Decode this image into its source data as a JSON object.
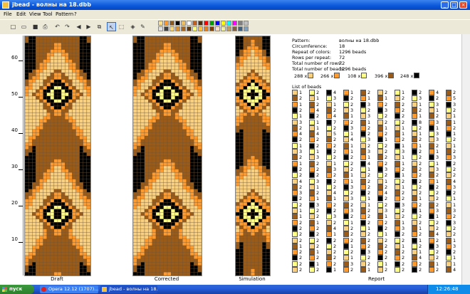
{
  "window": {
    "title": "jbead - волны на 18.dbb",
    "minimize_label": "_",
    "maximize_label": "□",
    "close_label": "×"
  },
  "menu": [
    {
      "label": "File"
    },
    {
      "label": "Edit"
    },
    {
      "label": "View"
    },
    {
      "label": "Tool"
    },
    {
      "label": "Pattern"
    },
    {
      "label": "?"
    }
  ],
  "toolbar": {
    "buttons": [
      {
        "name": "new-icon",
        "glyph": "□"
      },
      {
        "name": "open-icon",
        "glyph": "▭"
      },
      {
        "name": "save-icon",
        "glyph": "■"
      },
      {
        "name": "print-icon",
        "glyph": "⎙"
      },
      {
        "name": "undo-icon",
        "glyph": "↶"
      },
      {
        "name": "redo-icon",
        "glyph": "↷"
      },
      {
        "name": "rotate-left-icon",
        "glyph": "◀"
      },
      {
        "name": "rotate-right-icon",
        "glyph": "▶"
      },
      {
        "name": "copy-icon",
        "glyph": "⧉"
      },
      {
        "name": "pointer-icon",
        "glyph": "↖"
      },
      {
        "name": "select-icon",
        "glyph": "⬚"
      },
      {
        "name": "fill-icon",
        "glyph": "◈"
      },
      {
        "name": "pipette-icon",
        "glyph": "✎"
      }
    ],
    "palette": [
      "#ffe08a",
      "#ff9a2e",
      "#8a5a1e",
      "#000000",
      "#f0c060",
      "#ffffff",
      "#c06020",
      "#503010",
      "#ff0000",
      "#00a000",
      "#0000ff",
      "#ffff00",
      "#00ffff",
      "#ff00ff",
      "#808080",
      "#c0c0c0",
      "#e0e0e0",
      "#404040",
      "#f8d878",
      "#d89030",
      "#a86820",
      "#603810",
      "#ffff80",
      "#ffc040",
      "#e08020",
      "#804000",
      "#ffe0c0",
      "#f0f0a0",
      "#c0a060",
      "#806040",
      "#406080",
      "#80a0c0"
    ]
  },
  "ruler": {
    "ticks": [
      "60",
      "50",
      "40",
      "30",
      "20",
      "10"
    ]
  },
  "views": [
    {
      "label": "Draft"
    },
    {
      "label": "Corrected"
    },
    {
      "label": "Simulation"
    },
    {
      "label": "Report"
    }
  ],
  "info": {
    "rows": [
      {
        "label": "Pattern:",
        "value": "волны на 18.dbb"
      },
      {
        "label": "Circumference:",
        "value": "18"
      },
      {
        "label": "Repeat of colors:",
        "value": "1296 beads"
      },
      {
        "label": "Rows per repeat:",
        "value": "72"
      },
      {
        "label": "Total number of rows:",
        "value": "72"
      },
      {
        "label": "Total number of beads:",
        "value": "1296 beads"
      }
    ]
  },
  "bead_counts": [
    {
      "count": "288 x",
      "color": "#f8d080"
    },
    {
      "count": "266 x",
      "color": "#ff9a2e"
    },
    {
      "count": "108 x",
      "color": "#ffff88"
    },
    {
      "count": "396 x",
      "color": "#9a5a18"
    },
    {
      "count": "248 x",
      "color": "#000000"
    }
  ],
  "list_title": "List of beads",
  "colors": {
    "light": "#f8d080",
    "orange": "#ff9a2e",
    "yellow": "#ffff88",
    "brown": "#9a5a18",
    "black": "#000000",
    "grid": "#6a5030"
  },
  "bead_list": [
    [
      "1",
      "2",
      "4",
      "1",
      "2",
      "2",
      "1",
      "2",
      "4",
      "2"
    ],
    [
      "2",
      "1",
      "3",
      "2",
      "1",
      "1",
      "2",
      "3",
      "2",
      "5"
    ],
    [
      "1",
      "2",
      "1",
      "2",
      "3",
      "2",
      "2",
      "1",
      "3",
      "3"
    ],
    [
      "2",
      "4",
      "2",
      "3",
      "2",
      "3",
      "2",
      "2",
      "1",
      "2"
    ],
    [
      "1",
      "2",
      "4",
      "1",
      "3",
      "2",
      "2",
      "1",
      "2",
      "1"
    ],
    [
      "3",
      "1",
      "7",
      "2",
      "1",
      "2",
      "2",
      "8",
      "3",
      "1"
    ],
    [
      "2",
      "1",
      "2",
      "3",
      "2",
      "1",
      "1",
      "2",
      "1",
      "2"
    ],
    [
      "4",
      "4",
      "5",
      "1",
      "2",
      "2",
      "1",
      "1",
      "3",
      "1"
    ],
    [
      "2",
      "2",
      "2",
      "4",
      "3",
      "1",
      "2",
      "2",
      "3",
      "2"
    ],
    [
      "1",
      "2",
      "2",
      "1",
      "2",
      "2",
      "1",
      "1",
      "2",
      "1"
    ],
    [
      "3",
      "1",
      "2",
      "1",
      "3",
      "2",
      "3",
      "2",
      "1",
      "2"
    ],
    [
      "2",
      "3",
      "2",
      "2",
      "1",
      "2",
      "1",
      "2",
      "3",
      "3"
    ],
    [
      "1",
      "2",
      "1",
      "2",
      "4",
      "2",
      "1",
      "2",
      "1",
      "2"
    ],
    [
      "2",
      "2",
      "3",
      "2",
      "1",
      "3",
      "2",
      "2",
      "3",
      "2"
    ],
    [
      "2",
      "2",
      "2",
      "1",
      "2",
      "2",
      "1",
      "2",
      "2",
      "2"
    ],
    [
      "4",
      "3",
      "2",
      "1",
      "2",
      "1",
      "2",
      "2",
      "1",
      "4"
    ],
    [
      "2",
      "1",
      "2",
      "3",
      "2",
      "2",
      "1",
      "2",
      "2",
      "3"
    ],
    [
      "3",
      "2",
      "4",
      "2",
      "2",
      "4",
      "2",
      "2",
      "2",
      "2"
    ],
    [
      "2",
      "1",
      "1",
      "3",
      "1",
      "2",
      "2",
      "1",
      "2",
      "1"
    ],
    [
      "2",
      "3",
      "2",
      "2",
      "1",
      "2",
      "3",
      "2",
      "2",
      "1"
    ],
    [
      "1",
      "2",
      "2",
      "3",
      "2",
      "3",
      "2",
      "1",
      "3",
      "3"
    ],
    [
      "1",
      "2",
      "3",
      "2",
      "2",
      "1",
      "2",
      "2",
      "1",
      "2"
    ],
    [
      "2",
      "1",
      "2",
      "1",
      "2",
      "2",
      "1",
      "2",
      "2",
      "3"
    ],
    [
      "2",
      "2",
      "4",
      "2",
      "1",
      "2",
      "3",
      "1",
      "2",
      "2"
    ],
    [
      "2",
      "2",
      "1",
      "2",
      "2",
      "1",
      "2",
      "2",
      "4",
      "2"
    ],
    [
      "2",
      "2",
      "2",
      "2",
      "2",
      "2",
      "2",
      "1",
      "2",
      "1"
    ],
    [
      "1",
      "2",
      "2",
      "1",
      "2",
      "2",
      "1",
      "2",
      "3",
      "3"
    ],
    [
      "2",
      "1",
      "2",
      "2",
      "3",
      "2",
      "2",
      "1",
      "2",
      "2"
    ],
    [
      "2",
      "2",
      "2",
      "1",
      "2",
      "2",
      "2",
      "4",
      "2",
      "1"
    ],
    [
      "2",
      "1",
      "2",
      "3",
      "2",
      "1",
      "2",
      "2",
      "1",
      "1"
    ],
    [
      "2",
      "2",
      "1",
      "2",
      "1",
      "2",
      "2",
      "2",
      "2",
      "4"
    ]
  ],
  "taskbar": {
    "start_label": "пуск",
    "tasks": [
      {
        "label": "Opera 12.12 (1707)..."
      },
      {
        "label": "jbead - волны на 18..."
      }
    ],
    "clock": "12:26:48"
  }
}
